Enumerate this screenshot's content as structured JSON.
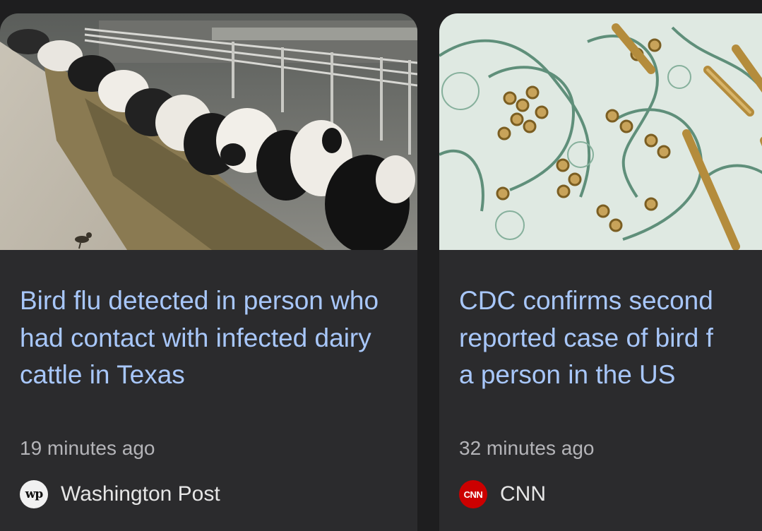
{
  "cards": [
    {
      "image": "dairy-cows-feeding-photo",
      "headline": "Bird flu detected in person who had contact with infected dairy cattle in Texas",
      "time": "19 minutes ago",
      "source": "Washington Post",
      "logo_text": "wp"
    },
    {
      "image": "avian-influenza-virus-micrograph",
      "headline_lines": [
        "CDC confirms second",
        "reported case of bird f",
        "a person in the US"
      ],
      "time": "32 minutes ago",
      "source": "CNN",
      "logo_text": "CNN"
    }
  ],
  "colors": {
    "background": "#1e1e1f",
    "card": "#2b2b2d",
    "headline": "#a8c7fa",
    "timestamp": "#b4b4b8",
    "source": "#e6e6e6",
    "cnn_logo": "#cc0000"
  }
}
